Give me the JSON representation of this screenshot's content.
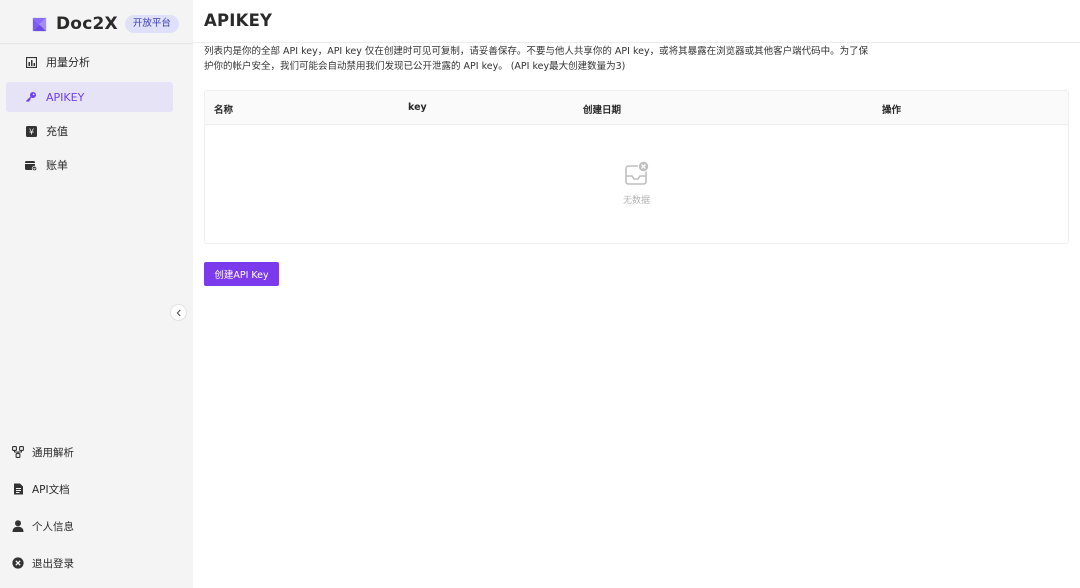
{
  "brand": {
    "name": "Doc2X",
    "badge": "开放平台",
    "accent": "#7c3aed"
  },
  "sidebar": {
    "items": [
      {
        "label": "用量分析",
        "icon": "bar-chart-icon",
        "active": false
      },
      {
        "label": "APIKEY",
        "icon": "key-icon",
        "active": true
      },
      {
        "label": "充值",
        "icon": "yen-icon",
        "active": false
      },
      {
        "label": "账单",
        "icon": "wallet-icon",
        "active": false
      }
    ],
    "bottom": [
      {
        "label": "通用解析",
        "icon": "flow-icon"
      },
      {
        "label": "API文档",
        "icon": "document-icon"
      },
      {
        "label": "个人信息",
        "icon": "user-icon"
      },
      {
        "label": "退出登录",
        "icon": "close-circle-icon"
      }
    ]
  },
  "main": {
    "title": "APIKEY",
    "description_line1": "列表内是你的全部 API key，API key 仅在创建时可见可复制，请妥善保存。不要与他人共享你的 API key，或将其暴露在浏览器或其他客户端代码中。为了保",
    "description_line2": "护你的帐户安全，我们可能会自动禁用我们发现已公开泄露的 API key。 (API key最大创建数量为3)",
    "table": {
      "columns": [
        "名称",
        "key",
        "创建日期",
        "操作"
      ],
      "empty_text": "无数据"
    },
    "create_button": "创建API Key"
  }
}
